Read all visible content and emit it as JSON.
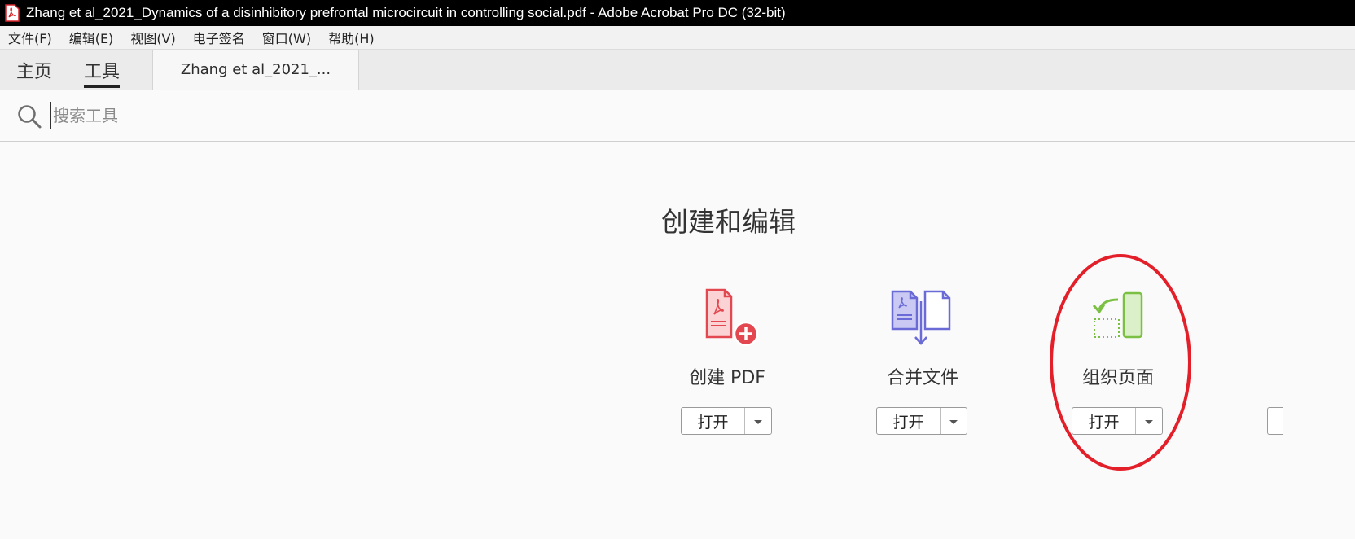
{
  "window": {
    "title": "Zhang et al_2021_Dynamics of a disinhibitory prefrontal microcircuit in controlling social.pdf - Adobe Acrobat Pro DC (32-bit)"
  },
  "menu": {
    "items": [
      {
        "label": "文件(F)"
      },
      {
        "label": "编辑(E)"
      },
      {
        "label": "视图(V)"
      },
      {
        "label": "电子签名"
      },
      {
        "label": "窗口(W)"
      },
      {
        "label": "帮助(H)"
      }
    ]
  },
  "tabs": {
    "home": "主页",
    "tools": "工具",
    "document": "Zhang et al_2021_...",
    "active": "tools"
  },
  "search": {
    "placeholder": "搜索工具",
    "value": ""
  },
  "section": {
    "heading": "创建和编辑"
  },
  "tools": [
    {
      "label": "创建 PDF",
      "open_label": "打开",
      "icon": "create-pdf-icon",
      "color": "#e34850"
    },
    {
      "label": "合并文件",
      "open_label": "打开",
      "icon": "combine-files-icon",
      "color": "#6b6bd8"
    },
    {
      "label": "组织页面",
      "open_label": "打开",
      "icon": "organize-pages-icon",
      "color": "#7cc043"
    }
  ],
  "annotation": {
    "shape": "ellipse",
    "color": "#e3202a",
    "target": "组织页面"
  },
  "colors": {
    "titlebar": "#000000",
    "background": "#fafafa"
  }
}
